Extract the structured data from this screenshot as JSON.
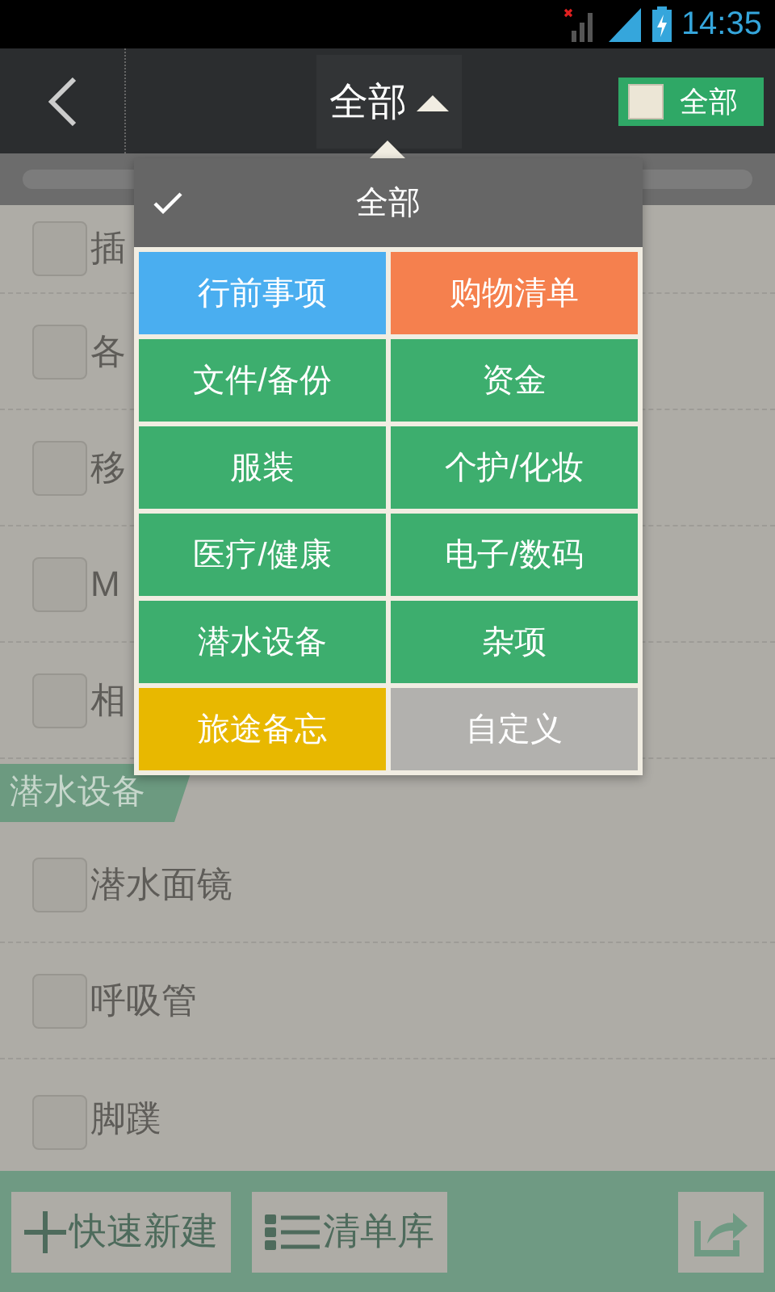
{
  "status_bar": {
    "time": "14:35"
  },
  "toolbar": {
    "title": "全部",
    "select_all": {
      "label": "全部",
      "checked": false
    }
  },
  "list": {
    "items": [
      {
        "kind": "item",
        "label": "插",
        "checked": false
      },
      {
        "kind": "item",
        "label": "各",
        "checked": false
      },
      {
        "kind": "item",
        "label": "移",
        "checked": false
      },
      {
        "kind": "item",
        "label": "M",
        "checked": false
      },
      {
        "kind": "item",
        "label": "相",
        "checked": false
      },
      {
        "kind": "section",
        "label": "潜水设备"
      },
      {
        "kind": "item",
        "label": "潜水面镜",
        "checked": false
      },
      {
        "kind": "item",
        "label": "呼吸管",
        "checked": false
      },
      {
        "kind": "item",
        "label": "脚蹼",
        "checked": false
      }
    ]
  },
  "category_menu": {
    "header": {
      "label": "全部",
      "selected": true
    },
    "items": [
      {
        "label": "行前事项",
        "color": "#4aaef0",
        "selected": false
      },
      {
        "label": "购物清单",
        "color": "#f5804e",
        "selected": false
      },
      {
        "label": "文件/备份",
        "color": "#3dae6e",
        "selected": false
      },
      {
        "label": "资金",
        "color": "#3dae6e",
        "selected": false
      },
      {
        "label": "服装",
        "color": "#3dae6e",
        "selected": false
      },
      {
        "label": "个护/化妆",
        "color": "#3dae6e",
        "selected": false
      },
      {
        "label": "医疗/健康",
        "color": "#3dae6e",
        "selected": false
      },
      {
        "label": "电子/数码",
        "color": "#3dae6e",
        "selected": false
      },
      {
        "label": "潜水设备",
        "color": "#3dae6e",
        "selected": false
      },
      {
        "label": "杂项",
        "color": "#3dae6e",
        "selected": false
      },
      {
        "label": "旅途备忘",
        "color": "#e8b800",
        "selected": false
      },
      {
        "label": "自定义",
        "color": "#b2b1ae",
        "selected": false
      }
    ]
  },
  "bottom_bar": {
    "buttons": [
      {
        "kind": "add",
        "label": "快速新建"
      },
      {
        "kind": "library",
        "label": "清单库"
      }
    ]
  }
}
